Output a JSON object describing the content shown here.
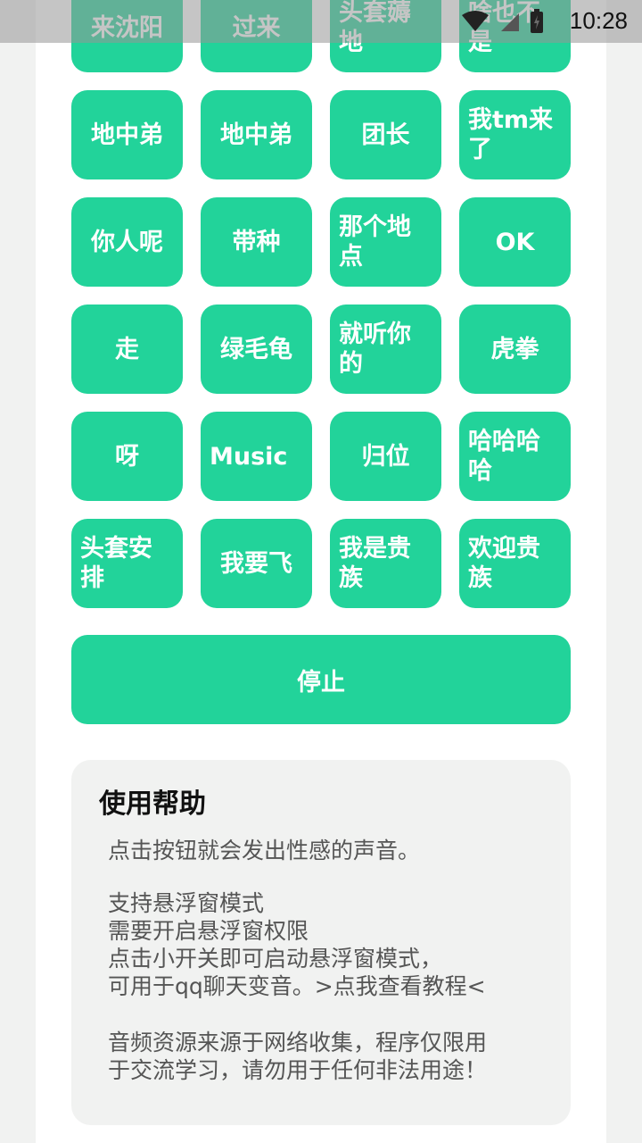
{
  "status_bar": {
    "time": "10:28"
  },
  "colors": {
    "accent": "#22d39a",
    "background": "#f1f2f1",
    "card": "#ffffff"
  },
  "sound_buttons": [
    {
      "label": "来沈阳"
    },
    {
      "label": "过来"
    },
    {
      "label": "头套薅地"
    },
    {
      "label": "啥也不是"
    },
    {
      "label": "地中弟"
    },
    {
      "label": "地中弟"
    },
    {
      "label": "团长"
    },
    {
      "label": "我tm来了"
    },
    {
      "label": "你人呢"
    },
    {
      "label": "带种"
    },
    {
      "label": "那个地点"
    },
    {
      "label": "OK"
    },
    {
      "label": "走"
    },
    {
      "label": "绿毛龟"
    },
    {
      "label": "就听你的"
    },
    {
      "label": "虎拳"
    },
    {
      "label": "呀"
    },
    {
      "label": "Music"
    },
    {
      "label": "归位"
    },
    {
      "label": "哈哈哈哈"
    },
    {
      "label": "头套安排"
    },
    {
      "label": "我要飞"
    },
    {
      "label": "我是贵族"
    },
    {
      "label": "欢迎贵族"
    }
  ],
  "stop_button": {
    "label": "停止"
  },
  "help": {
    "title": "使用帮助",
    "para1": "点击按钮就会发出性感的声音。",
    "para2_lines": [
      "支持悬浮窗模式",
      "需要开启悬浮窗权限",
      "点击小开关即可启动悬浮窗模式，",
      "可用于qq聊天变音。>点我查看教程<"
    ],
    "para3_lines": [
      "音频资源来源于网络收集，程序仅限用",
      "于交流学习，请勿用于任何非法用途！"
    ]
  }
}
